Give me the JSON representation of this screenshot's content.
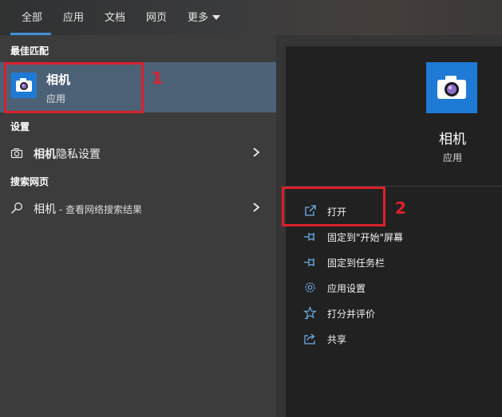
{
  "tabs": [
    {
      "label": "全部"
    },
    {
      "label": "应用"
    },
    {
      "label": "文档"
    },
    {
      "label": "网页"
    },
    {
      "label": "更多"
    }
  ],
  "left": {
    "best_match_header": "最佳匹配",
    "best_match": {
      "title": "相机",
      "subtitle": "应用",
      "icon": "camera-icon"
    },
    "settings_header": "设置",
    "settings_item": {
      "bold": "相机",
      "rest": "隐私设置",
      "icon": "camera-outline-icon"
    },
    "web_header": "搜索网页",
    "web_item": {
      "bold": "相机",
      "rest": " - 查看网络搜索结果",
      "icon": "search-icon"
    }
  },
  "right": {
    "app_name": "相机",
    "app_type": "应用",
    "actions": [
      {
        "label": "打开",
        "icon": "open-icon"
      },
      {
        "label": "固定到\"开始\"屏幕",
        "icon": "pin-start-icon"
      },
      {
        "label": "固定到任务栏",
        "icon": "pin-taskbar-icon"
      },
      {
        "label": "应用设置",
        "icon": "gear-icon"
      },
      {
        "label": "打分并评价",
        "icon": "star-rate-icon"
      },
      {
        "label": "共享",
        "icon": "share-icon"
      }
    ]
  },
  "annotations": [
    {
      "label": "1"
    },
    {
      "label": "2"
    }
  ],
  "colors": {
    "accent": "#3f8fd8",
    "selected": "#4d6176",
    "annotation": "#d9202b",
    "app_tile": "#1f7ad6"
  }
}
